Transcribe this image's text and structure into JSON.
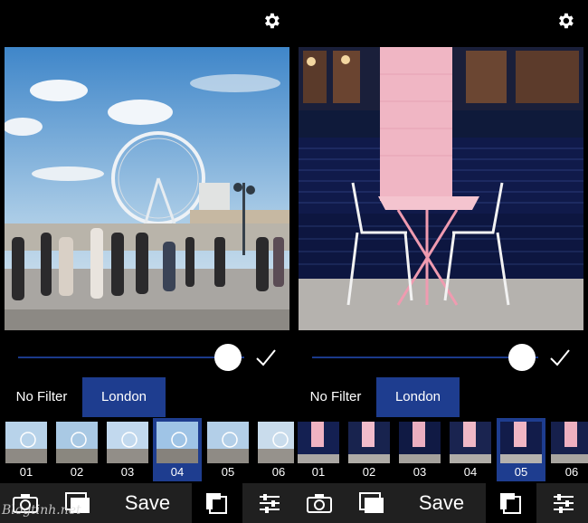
{
  "colors": {
    "accent": "#1e3d8f",
    "toolbar_bg": "#202020",
    "background": "#000000"
  },
  "icons": {
    "settings": "gear-icon",
    "camera": "camera-icon",
    "gallery": "gallery-icon",
    "filter": "filter-strip-icon",
    "adjust": "sliders-icon",
    "confirm": "check-icon"
  },
  "left_panel": {
    "photo": "london-eye-street-photo",
    "intensity": 0.83,
    "filters": {
      "none_label": "No Filter",
      "active_label": "London"
    },
    "thumbnails": [
      {
        "num": "01"
      },
      {
        "num": "02"
      },
      {
        "num": "03"
      },
      {
        "num": "04"
      },
      {
        "num": "05"
      },
      {
        "num": "06"
      }
    ],
    "selected_thumbnail": "04",
    "toolbar": {
      "save_label": "Save"
    }
  },
  "right_panel": {
    "photo": "pink-table-cafe-photo",
    "intensity": 0.83,
    "filters": {
      "none_label": "No Filter",
      "active_label": "London"
    },
    "thumbnails": [
      {
        "num": "01"
      },
      {
        "num": "02"
      },
      {
        "num": "03"
      },
      {
        "num": "04"
      },
      {
        "num": "05"
      },
      {
        "num": "06"
      }
    ],
    "selected_thumbnail": "05",
    "toolbar": {
      "save_label": "Save"
    }
  },
  "watermark": "Blogtinh.net"
}
